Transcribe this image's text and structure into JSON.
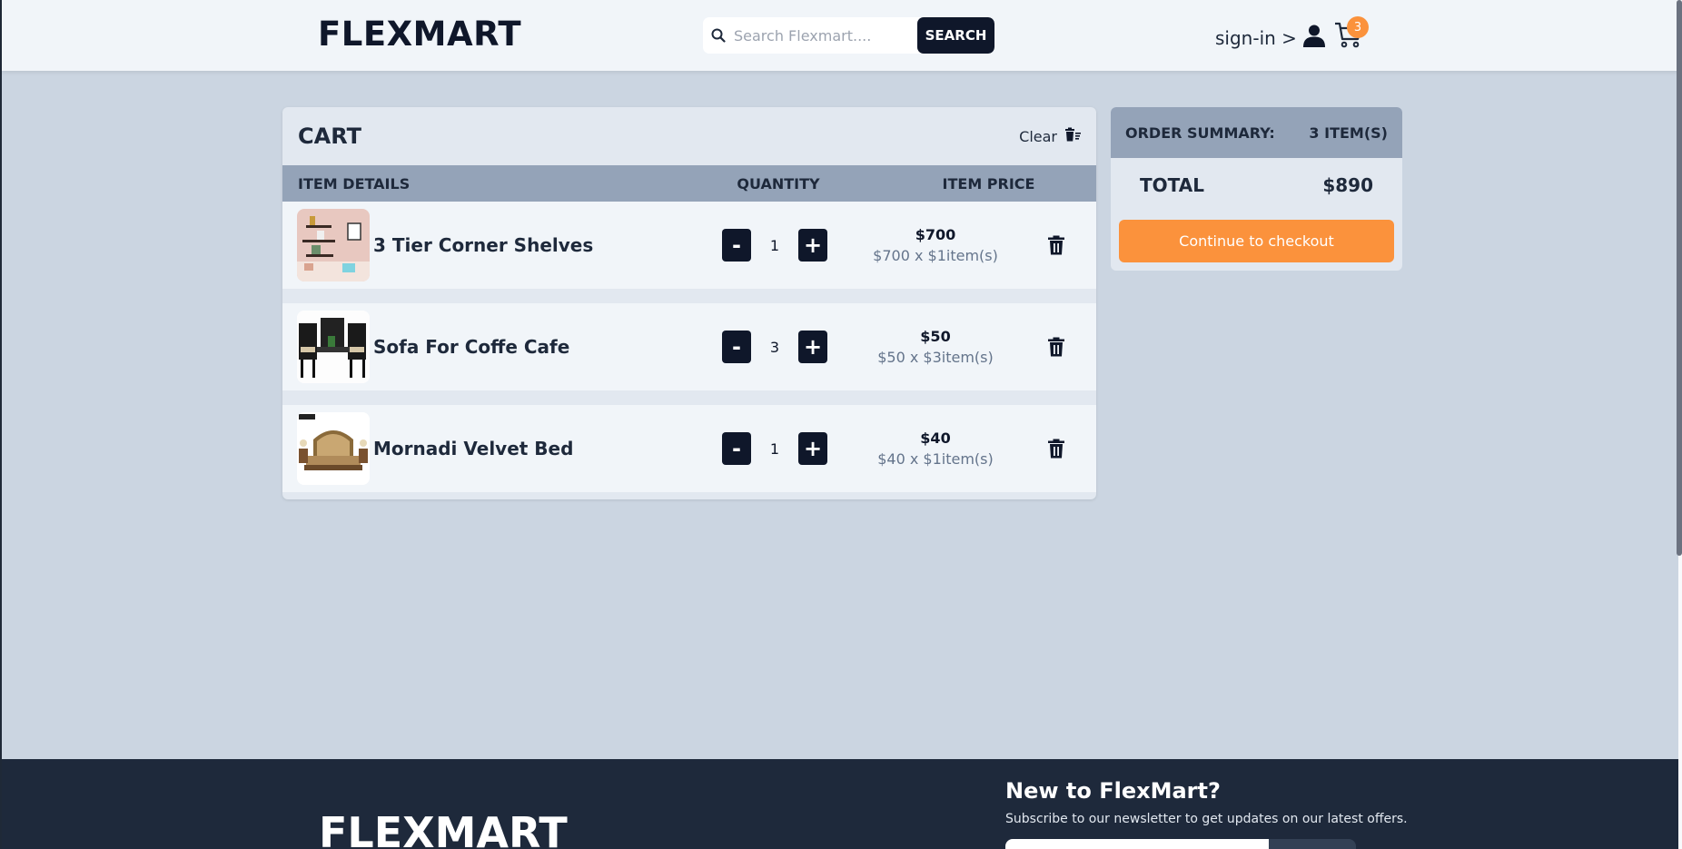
{
  "header": {
    "logo": "FLEXMART",
    "search_placeholder": "Search Flexmart....",
    "search_button": "SEARCH",
    "signin_label": "sign-in >",
    "cart_count": "3"
  },
  "cart": {
    "title": "CART",
    "clear_label": "Clear",
    "columns": {
      "details": "ITEM DETAILS",
      "quantity": "QUANTITY",
      "price": "ITEM PRICE"
    },
    "items": [
      {
        "name": "3 Tier Corner Shelves",
        "quantity": "1",
        "price": "$700",
        "price_detail": "$700 x $1item(s)",
        "minus": "-",
        "plus": "+"
      },
      {
        "name": "Sofa For Coffe Cafe",
        "quantity": "3",
        "price": "$50",
        "price_detail": "$50 x $3item(s)",
        "minus": "-",
        "plus": "+"
      },
      {
        "name": "Mornadi Velvet Bed",
        "quantity": "1",
        "price": "$40",
        "price_detail": "$40 x $1item(s)",
        "minus": "-",
        "plus": "+"
      }
    ]
  },
  "summary": {
    "heading": "ORDER SUMMARY:",
    "item_count": "3 ITEM(S)",
    "total_label": "TOTAL",
    "total_value": "$890",
    "checkout_label": "Continue to checkout"
  },
  "footer": {
    "logo": "FLEXMART",
    "heading": "New to FlexMart?",
    "text": "Subscribe to our newsletter to get updates on our latest offers."
  },
  "colors": {
    "accent": "#fb923c",
    "dark": "#0f172a",
    "page_bg": "#cbd5e1",
    "footer_bg": "#1e293b"
  }
}
